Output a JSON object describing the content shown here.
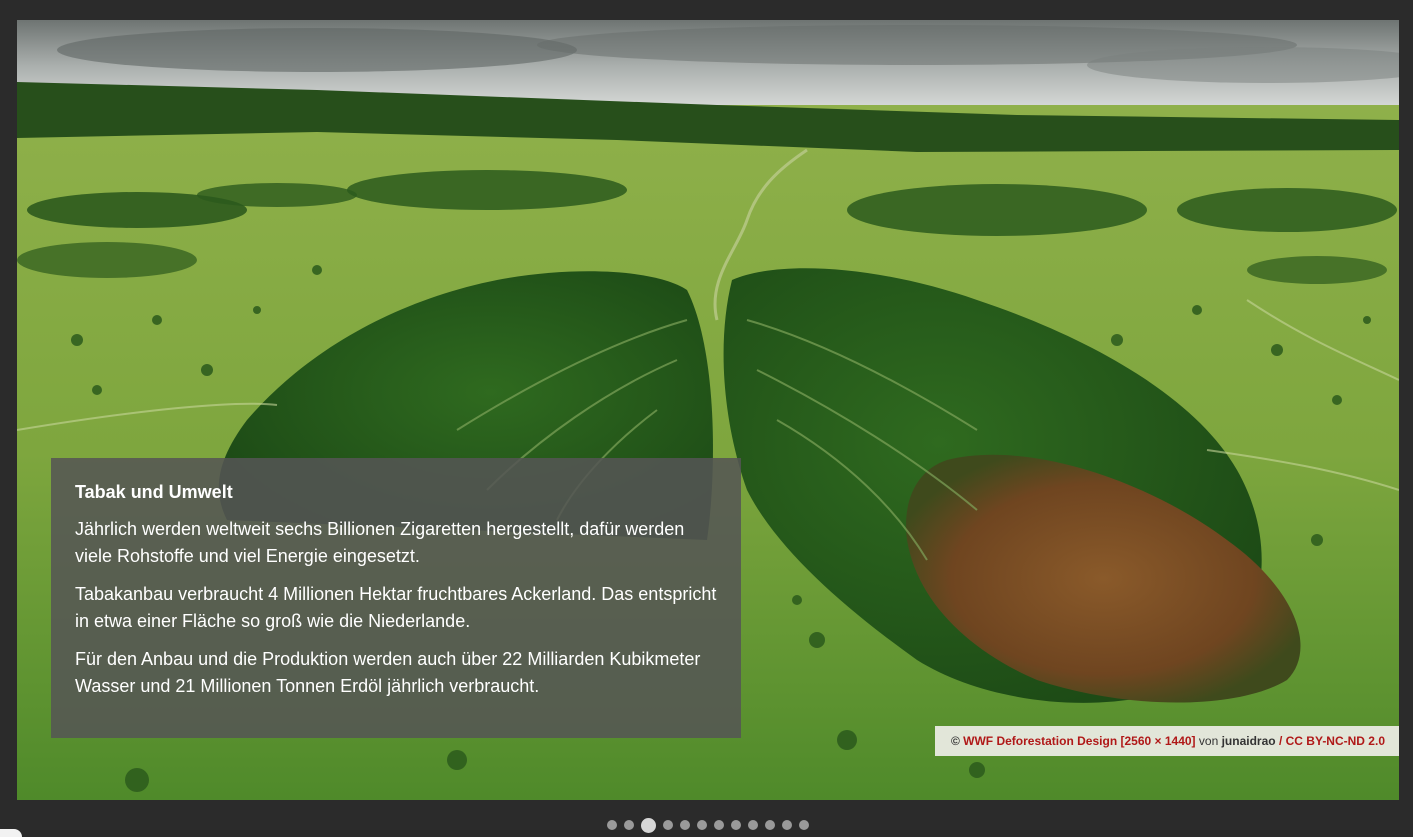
{
  "slide": {
    "title": "Tabak und Umwelt",
    "paragraphs": [
      "Jährlich werden weltweit sechs Billionen Zigaretten hergestellt, dafür werden viele Rohstoffe und viel Energie eingesetzt.",
      "Tabakanbau verbraucht 4 Millionen Hektar fruchtbares Ackerland. Das entspricht in etwa einer Fläche so groß wie die Niederlande.",
      "Für den Anbau und die Produktion werden auch über 22 Milliarden Kubikmeter Wasser und 21 Millionen Tonnen Erdöl jährlich verbraucht."
    ]
  },
  "credit": {
    "copyright": "©",
    "image_link": "WWF Deforestation Design [2560 × 1440]",
    "by": "von",
    "author": "junaidrao",
    "separator": "/",
    "license_link": "CC BY-NC-ND 2.0"
  },
  "pagination": {
    "total": 12,
    "active_index": 2
  },
  "colors": {
    "background": "#2b2b2b",
    "caption_bg": "#555555",
    "link": "#b01818",
    "dot": "#9a9a9a",
    "dot_active": "#d6d6d6"
  }
}
